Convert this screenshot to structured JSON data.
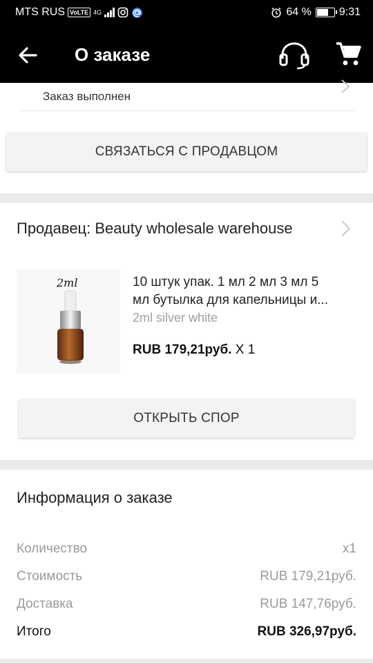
{
  "status_bar": {
    "carrier": "MTS RUS",
    "volte": "VoLTE",
    "network": "4G",
    "battery": "64 %",
    "battery_level": 0.64,
    "time": "9:31"
  },
  "app_bar": {
    "title": "О заказе",
    "back_icon": "arrow-left-icon",
    "support_icon": "headset-icon",
    "cart_icon": "cart-icon"
  },
  "order_status": {
    "text": "Заказ выполнен",
    "contact_button": "СВЯЗАТЬСЯ С ПРОДАВЦОМ"
  },
  "seller": {
    "label": "Продавец: Beauty wholesale warehouse",
    "product": {
      "image_label": "2ml",
      "title_line1": "10 штук упак. 1 мл 2 мл 3 мл 5",
      "title_line2": "мл бутылка для капельницы и...",
      "variant": "2ml silver white",
      "price": "RUB 179,21руб.",
      "quantity": "X 1"
    },
    "dispute_button": "ОТКРЫТЬ СПОР"
  },
  "order_info": {
    "title": "Информация о заказе",
    "rows": [
      {
        "label": "Количество",
        "value": "x1"
      },
      {
        "label": "Стоимость",
        "value": "RUB 179,21руб."
      },
      {
        "label": "Доставка",
        "value": "RUB 147,76руб."
      },
      {
        "label": "Итого",
        "value": "RUB 326,97руб."
      }
    ]
  },
  "colors": {
    "app_bar": "#000000",
    "background": "#ebebeb",
    "muted_text": "#9a9a9a"
  }
}
